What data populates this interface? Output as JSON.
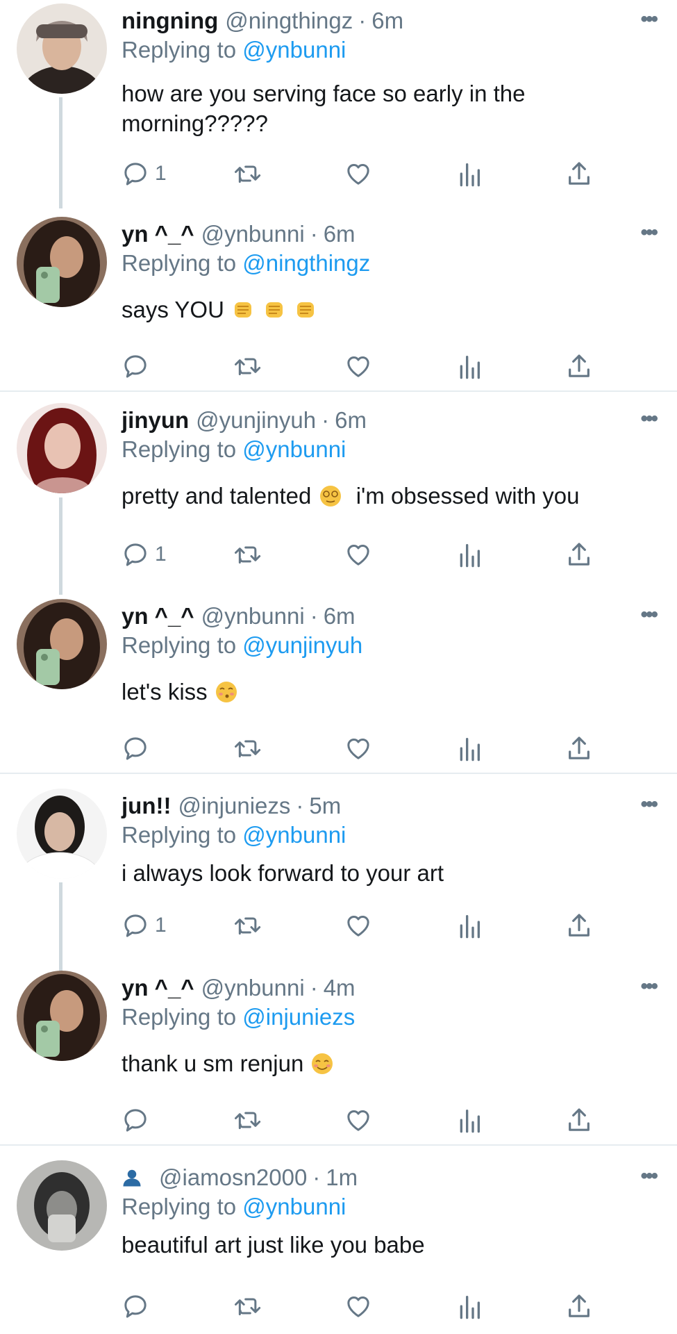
{
  "thread": [
    {
      "name": "ningning",
      "handle": "@ningthingz",
      "separator": "·",
      "time": "6m",
      "replying_prefix": "Replying to",
      "replying_to": "@ynbunni",
      "text": "how are you serving face so early in the morning?????",
      "reply_count": "1",
      "avatar_palette": [
        "#e9e3dd",
        "#2b2320",
        "#d9b59c",
        "#9a8c86"
      ]
    },
    {
      "name": "yn ^_^",
      "handle": "@ynbunni",
      "separator": "·",
      "time": "6m",
      "replying_prefix": "Replying to",
      "replying_to": "@ningthingz",
      "text": "says YOU",
      "emojis": [
        "fist-emoji",
        "fist-emoji",
        "fist-emoji"
      ],
      "reply_count": "",
      "avatar_palette": [
        "#8a6f5e",
        "#2a1c16",
        "#c79a7d",
        "#a3c9a6"
      ]
    },
    {
      "name": "jinyun",
      "handle": "@yunjinyuh",
      "separator": "·",
      "time": "6m",
      "replying_prefix": "Replying to",
      "replying_to": "@ynbunni",
      "text_before": "pretty and talented",
      "text_after": "i'm obsessed with you",
      "emoji": "dizzy-face-emoji",
      "reply_count": "1",
      "avatar_palette": [
        "#f1e4e2",
        "#6b1414",
        "#e8c2b3",
        "#c99590"
      ]
    },
    {
      "name": "yn ^_^",
      "handle": "@ynbunni",
      "separator": "·",
      "time": "6m",
      "replying_prefix": "Replying to",
      "replying_to": "@yunjinyuh",
      "text": "let's kiss",
      "emoji": "kissing-face-emoji",
      "reply_count": "",
      "avatar_palette": [
        "#8a6f5e",
        "#2a1c16",
        "#c79a7d",
        "#a3c9a6"
      ]
    },
    {
      "name": "jun!!",
      "handle": "@injuniezs",
      "separator": "·",
      "time": "5m",
      "replying_prefix": "Replying to",
      "replying_to": "@ynbunni",
      "text": "i always look forward to your art",
      "reply_count": "1",
      "avatar_palette": [
        "#f4f4f4",
        "#1d1a18",
        "#d7b8a4",
        "#ffffff"
      ]
    },
    {
      "name": "yn ^_^",
      "handle": "@ynbunni",
      "separator": "·",
      "time": "4m",
      "replying_prefix": "Replying to",
      "replying_to": "@injuniezs",
      "text": "thank u sm renjun",
      "emoji": "smiling-face-emoji",
      "reply_count": "",
      "avatar_palette": [
        "#8a6f5e",
        "#2a1c16",
        "#c79a7d",
        "#a3c9a6"
      ]
    },
    {
      "name": "",
      "handle": "@iamosn2000",
      "separator": "·",
      "time": "1m",
      "replying_prefix": "Replying to",
      "replying_to": "@ynbunni",
      "text": "beautiful art just like you babe",
      "reply_count": "",
      "avatar_palette": [
        "#b7b7b4",
        "#2f2f2f",
        "#8d8d8a",
        "#d3d3d0"
      ]
    }
  ],
  "colors": {
    "text_primary": "#14171a",
    "text_secondary": "#657786",
    "mention": "#1d9bf0",
    "divider": "#e6ecf0",
    "thread_line": "#cfd9de"
  },
  "icons": [
    "more-icon",
    "reply-icon",
    "retweet-icon",
    "like-icon",
    "analytics-icon",
    "share-icon",
    "person-icon"
  ]
}
